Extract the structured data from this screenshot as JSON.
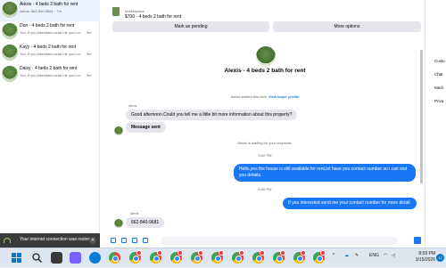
{
  "conversations": [
    {
      "name": "Alexis · 4 beds 2 bath for rent",
      "preview": "Alexis: 662-840-9681 · 7m"
    },
    {
      "name": "Don · 4 beds 2 bath for rent",
      "preview": "You: If you interested send me your co... · 9m"
    },
    {
      "name": "Kayy · 4 beds 2 bath for rent",
      "preview": "You: If you interested send me your co... · 9m"
    },
    {
      "name": "Daisy · 4 beds 2 bath for rent",
      "preview": "You: If you interested send me your co... · 9m"
    }
  ],
  "toast": {
    "message": "Your internet connection was restored."
  },
  "listing": {
    "source": "Marketplace",
    "title": "$700 · 4 beds 2 bath for rent"
  },
  "actions": {
    "pending_label": "Mark as pending",
    "more_label": "More options"
  },
  "chat": {
    "title": "Alexis - 4 beds 2 bath for rent",
    "started_text": "Alexis started this chat.",
    "view_profile_label": "View buyer profile",
    "msg1_sender": "Alexis",
    "msg1": "Good afternoon.Could you tell me a little bit more information about this property?",
    "msg2": "Message sent",
    "waiting": "Alexis is waiting for your response.",
    "time1": "5:52 PM",
    "msg3": "Hello,yes the house is still available for rent,let have you contact number so i can snd you details.",
    "time2": "6:40 PM",
    "msg4": "If you interested send me your contact number for more detail.",
    "msg5_sender": "Alexis",
    "msg5": "662-840-9681"
  },
  "right_panel": {
    "items": [
      "Custo",
      "Chat",
      "Medi",
      "Priva"
    ]
  },
  "taskbar": {
    "lang": "ENG",
    "time": "8:59 PM",
    "date": "3/15/2026",
    "notif_count": "12"
  },
  "colors": {
    "accent": "#1877f2",
    "bubble_in": "#e4e6eb"
  }
}
